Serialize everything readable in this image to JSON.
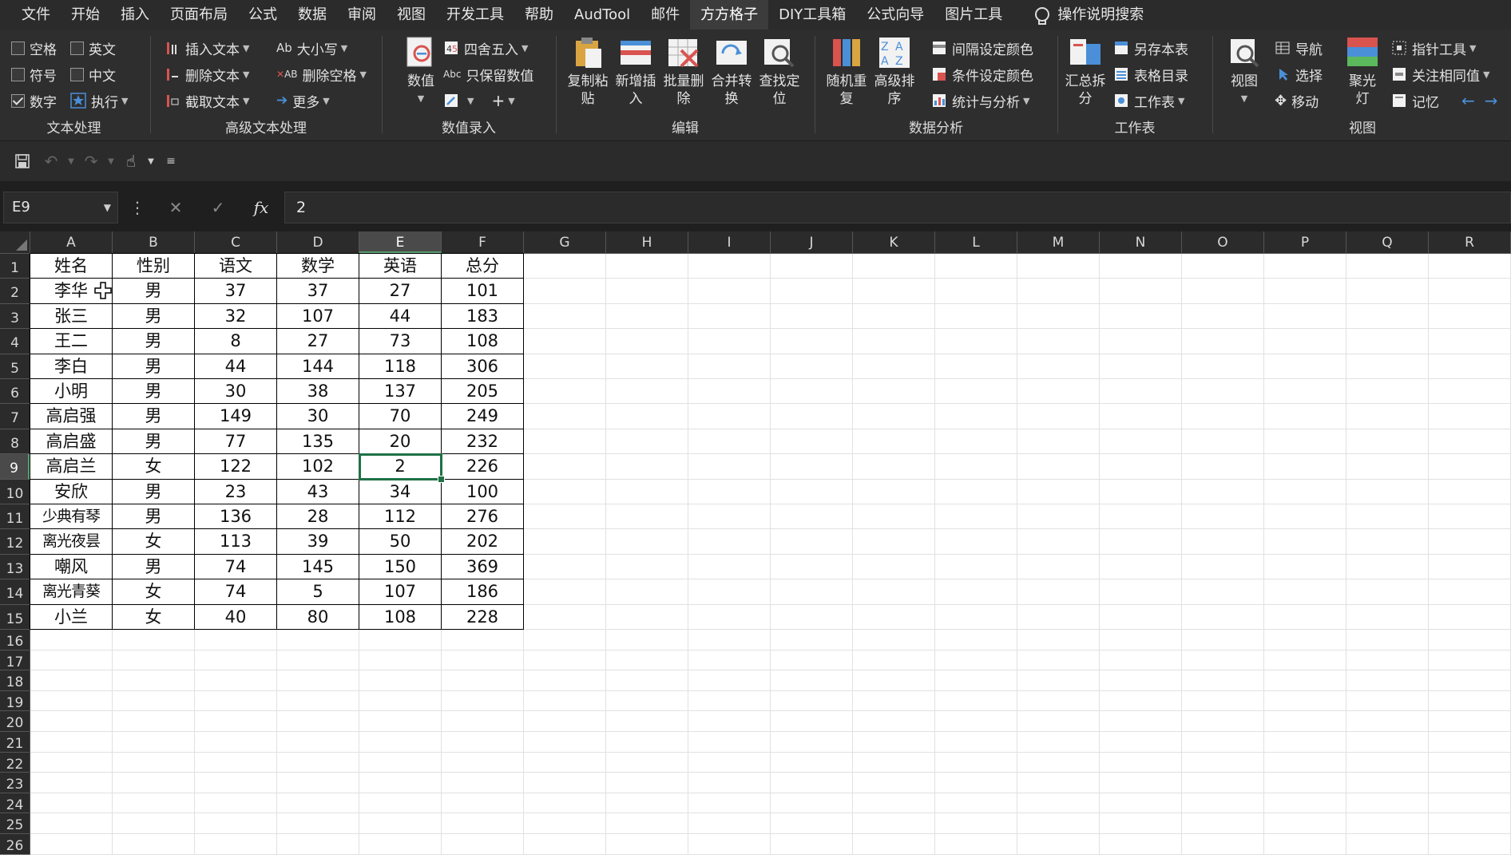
{
  "menu": {
    "tabs": [
      "文件",
      "开始",
      "插入",
      "页面布局",
      "公式",
      "数据",
      "审阅",
      "视图",
      "开发工具",
      "帮助",
      "AudTool",
      "邮件",
      "方方格子",
      "DIY工具箱",
      "公式向导",
      "图片工具"
    ],
    "active_tab": "方方格子",
    "search_label": "操作说明搜索"
  },
  "ribbon": {
    "text_group": {
      "label": "文本处理",
      "checks": [
        {
          "label": "空格",
          "checked": false
        },
        {
          "label": "英文",
          "checked": false
        },
        {
          "label": "符号",
          "checked": false
        },
        {
          "label": "中文",
          "checked": false
        },
        {
          "label": "数字",
          "checked": true
        }
      ],
      "execute": "执行"
    },
    "adv_text_group": {
      "label": "高级文本处理",
      "insert_text": "插入文本",
      "delete_text": "删除文本",
      "extract_text": "截取文本",
      "case": "大小写",
      "delete_space": "删除空格",
      "more": "更多"
    },
    "value_group": {
      "label": "数值录入",
      "value": "数值",
      "round": "四舍五入",
      "keep_value": "只保留数值"
    },
    "edit_group": {
      "label": "编辑",
      "buttons": [
        "复制粘\n贴",
        "新增插\n入",
        "批量删\n除",
        "合并转\n换",
        "查找定\n位"
      ]
    },
    "analysis_group": {
      "label": "数据分析",
      "buttons": [
        "随机重\n复",
        "高级排\n序"
      ],
      "interval_color": "间隔设定颜色",
      "cond_color": "条件设定颜色",
      "stats": "统计与分析"
    },
    "sheet_group": {
      "label": "工作表",
      "summary": "汇总拆\n分",
      "save_as": "另存本表",
      "catalog": "表格目录",
      "worksheet": "工作表"
    },
    "view_group": {
      "label": "视图",
      "view": "视图",
      "nav": "导航",
      "select": "选择",
      "move": "移动",
      "spotlight": "聚光\n灯",
      "pointer": "指针工具",
      "focus_same": "关注相同值",
      "memory": "记忆"
    }
  },
  "formula_bar": {
    "name_box": "E9",
    "fx": "fx",
    "value": "2"
  },
  "sheet": {
    "columns": [
      "A",
      "B",
      "C",
      "D",
      "E",
      "F",
      "G",
      "H",
      "I",
      "J",
      "K",
      "L",
      "M",
      "N",
      "O",
      "P",
      "Q",
      "R"
    ],
    "selected_column": "E",
    "selected_row": 9,
    "row_count": 26,
    "table": [
      [
        "姓名",
        "性别",
        "语文",
        "数学",
        "英语",
        "总分"
      ],
      [
        "李华",
        "男",
        "37",
        "37",
        "27",
        "101"
      ],
      [
        "张三",
        "男",
        "32",
        "107",
        "44",
        "183"
      ],
      [
        "王二",
        "男",
        "8",
        "27",
        "73",
        "108"
      ],
      [
        "李白",
        "男",
        "44",
        "144",
        "118",
        "306"
      ],
      [
        "小明",
        "男",
        "30",
        "38",
        "137",
        "205"
      ],
      [
        "高启强",
        "男",
        "149",
        "30",
        "70",
        "249"
      ],
      [
        "高启盛",
        "男",
        "77",
        "135",
        "20",
        "232"
      ],
      [
        "高启兰",
        "女",
        "122",
        "102",
        "2",
        "226"
      ],
      [
        "安欣",
        "男",
        "23",
        "43",
        "34",
        "100"
      ],
      [
        "少典有琴",
        "男",
        "136",
        "28",
        "112",
        "276"
      ],
      [
        "离光夜昙",
        "女",
        "113",
        "39",
        "50",
        "202"
      ],
      [
        "嘲风",
        "男",
        "74",
        "145",
        "150",
        "369"
      ],
      [
        "离光青葵",
        "女",
        "74",
        "5",
        "107",
        "186"
      ],
      [
        "小兰",
        "女",
        "40",
        "80",
        "108",
        "228"
      ]
    ]
  }
}
